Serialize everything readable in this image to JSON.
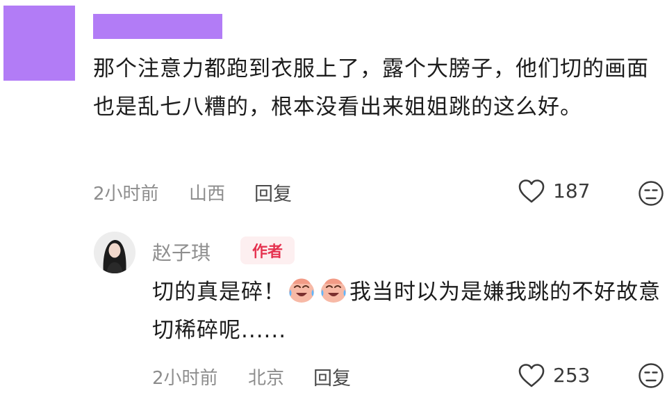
{
  "comment": {
    "text_before": "那个注意力都跑到衣服上了，露个大膀子，他们切的画面也是乱七八糟的，根本没看出来姐姐跳的这么好。",
    "time": "2小时前",
    "location": "山西",
    "reply_label": "回复",
    "like_count": "187"
  },
  "reply": {
    "author": "赵子琪",
    "badge": "作者",
    "text_start": "切的真是碎！",
    "emoji_icon": "crying-laughing-emoji",
    "text_end": "我当时以为是嫌我跳的不好故意切稀碎呢......",
    "time": "2小时前",
    "location": "北京",
    "reply_label": "回复",
    "like_count": "253"
  },
  "colors": {
    "redaction": "#b27cf6",
    "badge_text": "#e53350",
    "badge_bg": "#fdeff0",
    "meta": "#8d8d8d"
  }
}
